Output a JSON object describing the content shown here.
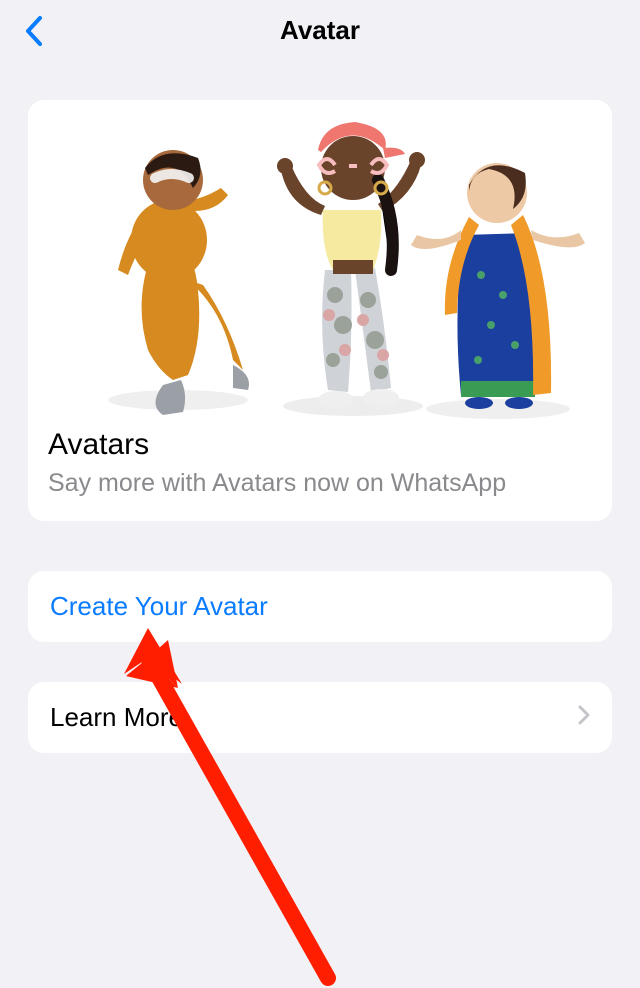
{
  "nav": {
    "title": "Avatar"
  },
  "hero": {
    "title": "Avatars",
    "subtitle": "Say more with Avatars now on WhatsApp"
  },
  "actions": {
    "create_label": "Create Your Avatar",
    "learn_label": "Learn More"
  },
  "colors": {
    "link_blue": "#0a7cff",
    "bg": "#f2f2f6",
    "subtext": "#8a8a8e",
    "arrow": "#ff1e00"
  }
}
